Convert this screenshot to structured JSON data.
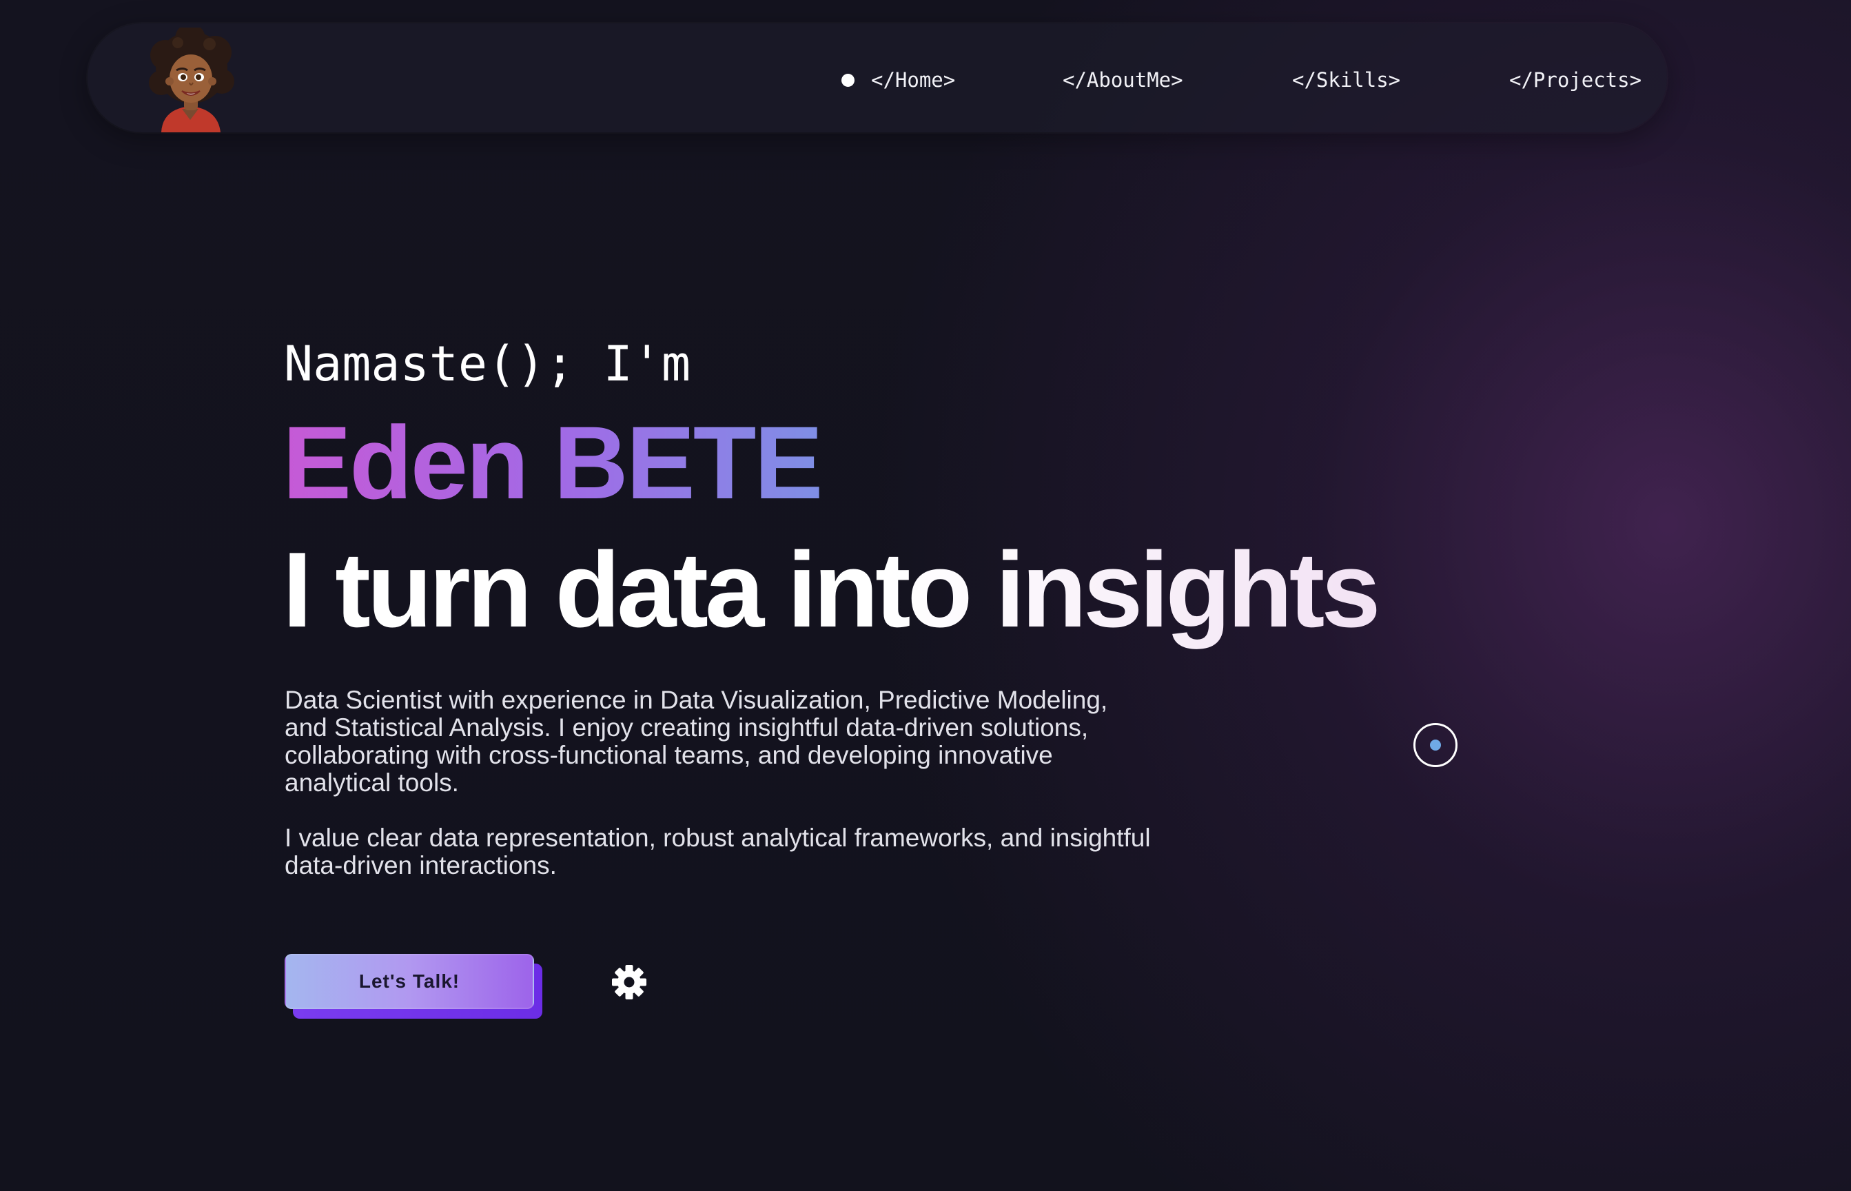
{
  "nav": {
    "active": "home",
    "links": [
      {
        "id": "home",
        "label": "</Home>"
      },
      {
        "id": "about",
        "label": "</AboutMe>"
      },
      {
        "id": "skills",
        "label": "</Skills>"
      },
      {
        "id": "projects",
        "label": "</Projects>"
      }
    ],
    "avatar_icon": "avatar-illustration"
  },
  "hero": {
    "greeting": "Namaste(); I'm",
    "name": "Eden BETE",
    "tagline": "I turn data into insights",
    "bio": [
      "Data Scientist with experience in Data Visualization, Predictive Modeling, and Statistical Analysis. I enjoy creating insightful data-driven solutions, collaborating with cross-functional teams, and developing innovative analytical tools.",
      "I value clear data representation, robust analytical frameworks, and insightful data-driven interactions."
    ],
    "cta_label": "Let's Talk!",
    "settings_icon": "gear-icon"
  },
  "theme": {
    "background": "#11111c",
    "glow": "#5c2c6c",
    "name_gradient": [
      "#c65ad6",
      "#a16ae6",
      "#7f8fe6"
    ],
    "cta_gradient": [
      "#a4b6ef",
      "#9d64ea"
    ],
    "cta_shadow": "#6c2de6",
    "cursor_dot": "#6fa9e6"
  }
}
